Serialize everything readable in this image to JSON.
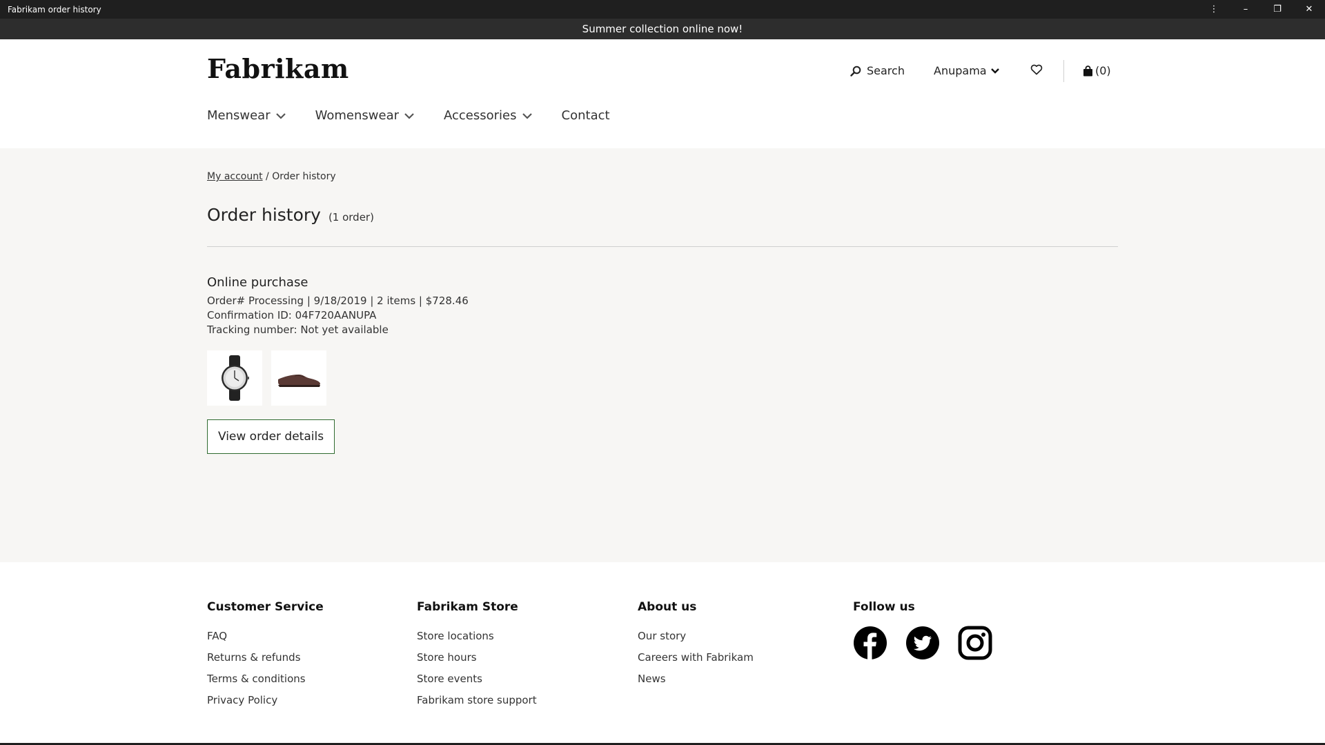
{
  "window": {
    "title": "Fabrikam order history",
    "more_icon": "⋮",
    "minimize_icon": "–",
    "restore_icon": "❐",
    "close_icon": "✕"
  },
  "promo": {
    "text": "Summer collection online now!"
  },
  "header": {
    "logo": "Fabrikam",
    "search_label": "Search",
    "user_label": "Anupama",
    "cart_label": "(0)"
  },
  "nav": {
    "items": [
      {
        "label": "Menswear"
      },
      {
        "label": "Womenswear"
      },
      {
        "label": "Accessories"
      },
      {
        "label": "Contact"
      }
    ]
  },
  "breadcrumb": {
    "parent": "My account",
    "separator": " / ",
    "current": "Order history"
  },
  "page": {
    "title": "Order history",
    "count": "(1 order)"
  },
  "order": {
    "type": "Online purchase",
    "summary": "Order# Processing | 9/18/2019 | 2 items | $728.46",
    "confirmation": "Confirmation ID: 04F720AANUPA",
    "tracking": "Tracking number: Not yet available",
    "button_label": "View order details"
  },
  "footer": {
    "customer_service": {
      "title": "Customer Service",
      "links": [
        "FAQ",
        "Returns & refunds",
        "Terms & conditions",
        "Privacy Policy"
      ]
    },
    "store": {
      "title": "Fabrikam Store",
      "links": [
        "Store locations",
        "Store hours",
        "Store events",
        "Fabrikam store support"
      ]
    },
    "about": {
      "title": "About us",
      "links": [
        "Our story",
        "Careers with Fabrikam",
        "News"
      ]
    },
    "follow": {
      "title": "Follow us"
    }
  }
}
